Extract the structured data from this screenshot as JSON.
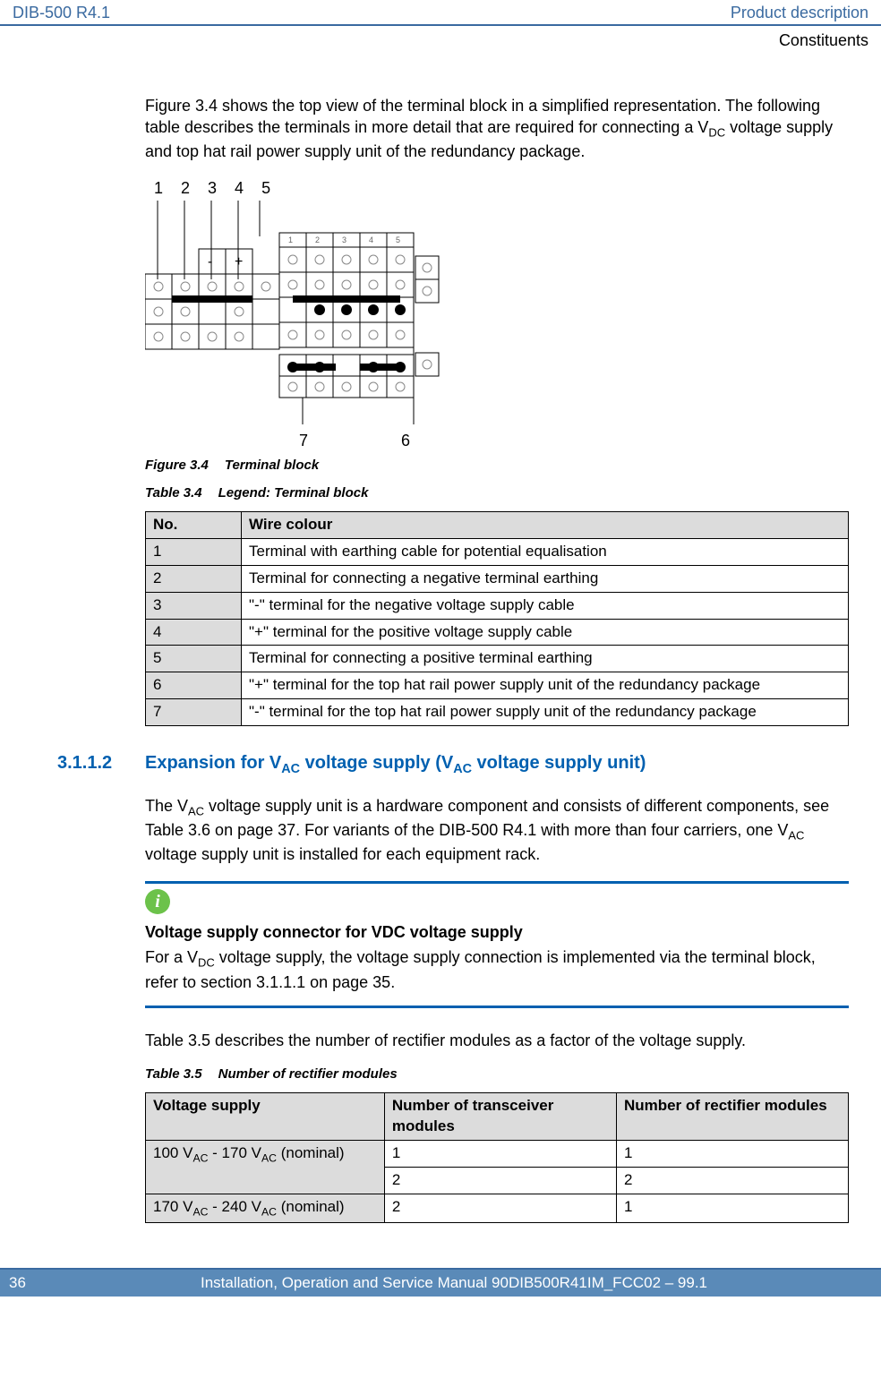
{
  "header": {
    "doc_code": "DIB-500 R4.1",
    "chapter": "Product description",
    "section": "Constituents"
  },
  "intro_para": "Figure 3.4 shows the top view of the terminal block in a simplified representation. The following table describes the terminals in more detail that are required for connecting a V",
  "intro_para_sub": "DC",
  "intro_para_rest": " voltage supply and top hat rail power supply unit of the redundancy package.",
  "diagram": {
    "top_labels": [
      "1",
      "2",
      "3",
      "4",
      "5"
    ],
    "bottom_left": "7",
    "bottom_right": "6",
    "minus": "-",
    "plus": "+"
  },
  "fig34_label": "Figure 3.4",
  "fig34_title": "Terminal block",
  "tbl34_label": "Table 3.4",
  "tbl34_title": "Legend: Terminal block",
  "tbl34_h1": "No.",
  "tbl34_h2": "Wire colour",
  "tbl34_rows": [
    {
      "no": "1",
      "txt": "Terminal with earthing cable for potential equalisation"
    },
    {
      "no": "2",
      "txt": "Terminal for connecting a negative terminal earthing"
    },
    {
      "no": "3",
      "txt": "\"-\" terminal for the negative voltage supply cable"
    },
    {
      "no": "4",
      "txt": "\"+\" terminal for the positive voltage supply cable"
    },
    {
      "no": "5",
      "txt": "Terminal for connecting a positive terminal earthing"
    },
    {
      "no": "6",
      "txt": "\"+\" terminal for the top hat rail power supply unit of the redundancy package"
    },
    {
      "no": "7",
      "txt": "\"-\" terminal for the top hat rail power supply unit of the redundancy package"
    }
  ],
  "sec3112_num": "3.1.1.2",
  "sec3112_title_pre": "Expansion for V",
  "sec3112_title_sub1": "AC",
  "sec3112_title_mid": " voltage supply (V",
  "sec3112_title_sub2": "AC",
  "sec3112_title_post": " voltage supply unit)",
  "sec3112_p1_a": "The V",
  "sec3112_p1_sub1": "AC",
  "sec3112_p1_b": " voltage supply unit is a hardware component and consists of different components, see Table 3.6 on page 37. For variants of the DIB-500 R4.1 with more than four carriers, one V",
  "sec3112_p1_sub2": "AC",
  "sec3112_p1_c": " voltage supply unit is installed for each equipment rack.",
  "info_title": "Voltage supply connector for VDC voltage supply",
  "info_p1_a": "For a V",
  "info_p1_sub": "DC",
  "info_p1_b": " voltage supply, the voltage supply connection is implemented via the terminal block, refer to section 3.1.1.1 on page 35.",
  "tbl35_intro": "Table 3.5 describes the number of rectifier modules as a factor of the voltage supply.",
  "tbl35_label": "Table 3.5",
  "tbl35_title": "Number of rectifier modules",
  "tbl35_h1": "Voltage supply",
  "tbl35_h2": "Number of transceiver modules",
  "tbl35_h3": "Number of rectifier modules",
  "tbl35_r1_vs_a": "100 V",
  "tbl35_r1_vs_sub1": "AC",
  "tbl35_r1_vs_b": " - 170 V",
  "tbl35_r1_vs_sub2": "AC",
  "tbl35_r1_vs_c": " (nominal)",
  "tbl35_r1a_t": "1",
  "tbl35_r1a_r": "1",
  "tbl35_r1b_t": "2",
  "tbl35_r1b_r": "2",
  "tbl35_r2_vs_a": "170 V",
  "tbl35_r2_vs_sub1": "AC",
  "tbl35_r2_vs_b": " - 240 V",
  "tbl35_r2_vs_sub2": "AC",
  "tbl35_r2_vs_c": " (nominal)",
  "tbl35_r2_t": "2",
  "tbl35_r2_r": "1",
  "footer": {
    "page": "36",
    "text": "Installation, Operation and Service Manual 90DIB500R41IM_FCC02 – 99.1"
  }
}
